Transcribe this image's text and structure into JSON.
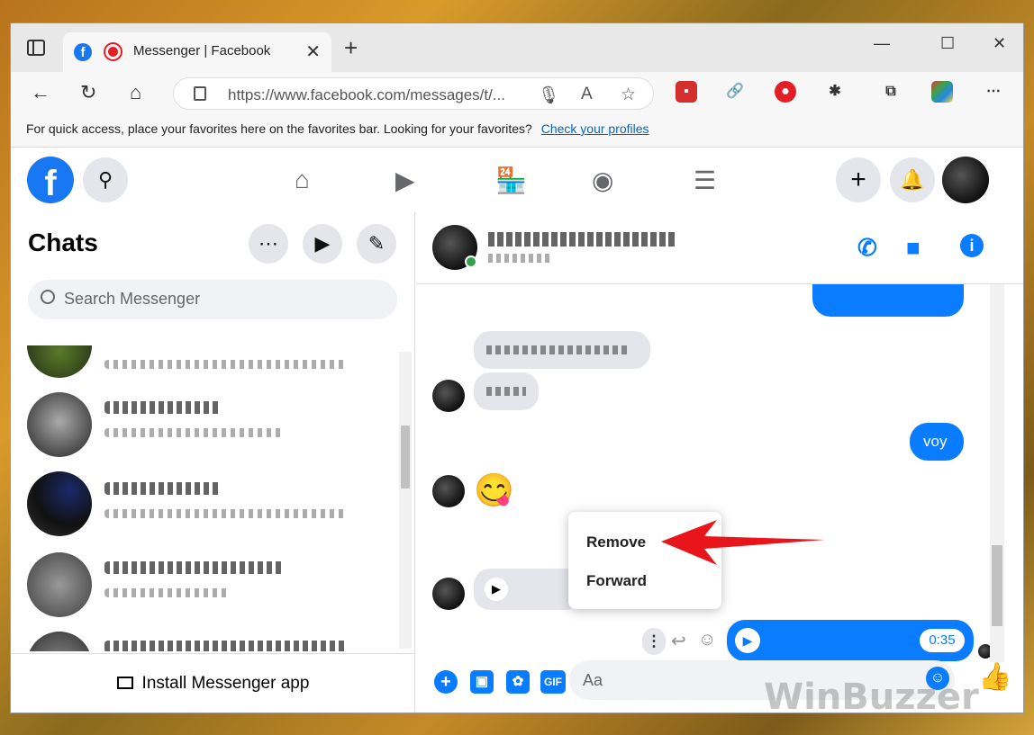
{
  "browser": {
    "tab_title": "Messenger | Facebook",
    "url": "https://www.facebook.com/messages/t/...",
    "favbar_text": "For quick access, place your favorites here on the favorites bar. Looking for your favorites?",
    "favbar_link": "Check your profiles"
  },
  "fb": {
    "logo": "f"
  },
  "chats": {
    "title": "Chats",
    "search_placeholder": "Search Messenger",
    "install_label": "Install Messenger app"
  },
  "conversation": {
    "message_voy": "voy",
    "emoji": "😋",
    "audio_duration": "0:35",
    "menu": {
      "remove": "Remove",
      "forward": "Forward"
    },
    "composer_placeholder": "Aa",
    "composer_gif": "GIF"
  },
  "watermark": "WinBuzzer",
  "colors": {
    "messenger_blue": "#0a7cff",
    "facebook_blue": "#1877f2",
    "arrow_red": "#e8151b"
  }
}
